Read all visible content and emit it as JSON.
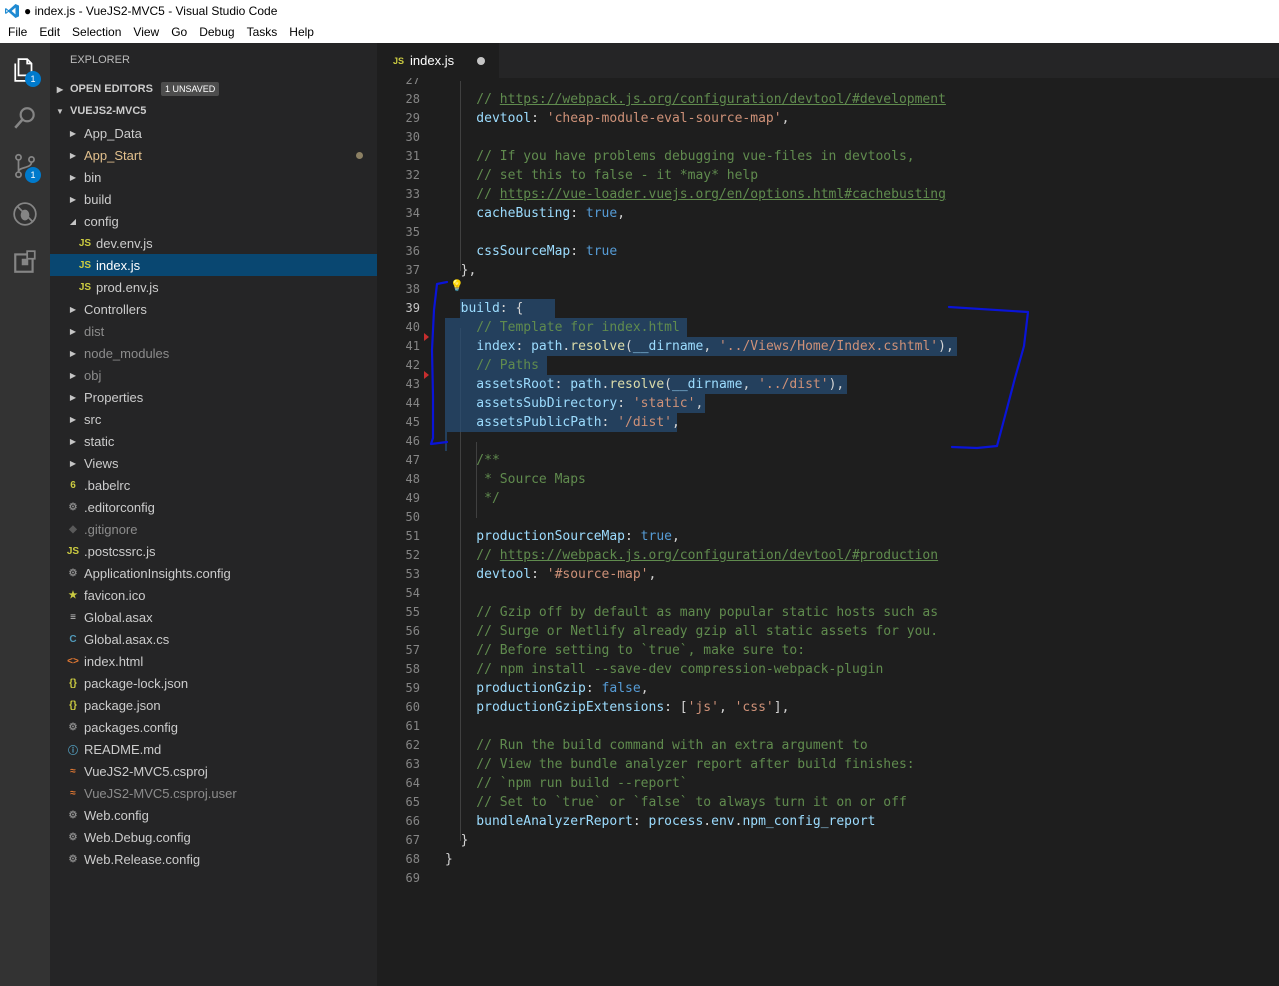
{
  "window": {
    "title": "● index.js - VueJS2-MVC5 - Visual Studio Code"
  },
  "menu": [
    "File",
    "Edit",
    "Selection",
    "View",
    "Go",
    "Debug",
    "Tasks",
    "Help"
  ],
  "activity_bar": {
    "items": [
      {
        "name": "explorer-icon",
        "badge": "1"
      },
      {
        "name": "search-icon",
        "badge": ""
      },
      {
        "name": "source-control-icon",
        "badge": "1"
      },
      {
        "name": "debug-icon",
        "badge": ""
      },
      {
        "name": "extensions-icon",
        "badge": ""
      }
    ]
  },
  "sidebar": {
    "header": "EXPLORER",
    "open_editors": {
      "label": "OPEN EDITORS",
      "badge": "1 UNSAVED"
    },
    "project": {
      "label": "VUEJS2-MVC5"
    },
    "tree": [
      {
        "label": "App_Data",
        "type": "folder",
        "depth": 0,
        "expanded": false
      },
      {
        "label": "App_Start",
        "type": "folder",
        "depth": 0,
        "expanded": false,
        "modified": true,
        "color": "#e2c08d"
      },
      {
        "label": "bin",
        "type": "folder",
        "depth": 0,
        "expanded": false
      },
      {
        "label": "build",
        "type": "folder",
        "depth": 0,
        "expanded": false
      },
      {
        "label": "config",
        "type": "folder",
        "depth": 0,
        "expanded": true
      },
      {
        "label": "dev.env.js",
        "type": "js",
        "depth": 1
      },
      {
        "label": "index.js",
        "type": "js",
        "depth": 1,
        "selected": true
      },
      {
        "label": "prod.env.js",
        "type": "js",
        "depth": 1
      },
      {
        "label": "Controllers",
        "type": "folder",
        "depth": 0,
        "expanded": false
      },
      {
        "label": "dist",
        "type": "folder",
        "depth": 0,
        "expanded": false,
        "color": "#8c8c8c"
      },
      {
        "label": "node_modules",
        "type": "folder",
        "depth": 0,
        "expanded": false,
        "color": "#8c8c8c"
      },
      {
        "label": "obj",
        "type": "folder",
        "depth": 0,
        "expanded": false,
        "color": "#8c8c8c"
      },
      {
        "label": "Properties",
        "type": "folder",
        "depth": 0,
        "expanded": false
      },
      {
        "label": "src",
        "type": "folder",
        "depth": 0,
        "expanded": false
      },
      {
        "label": "static",
        "type": "folder",
        "depth": 0,
        "expanded": false
      },
      {
        "label": "Views",
        "type": "folder",
        "depth": 0,
        "expanded": false
      },
      {
        "label": ".babelrc",
        "type": "babel",
        "depth": 0
      },
      {
        "label": ".editorconfig",
        "type": "gear",
        "depth": 0
      },
      {
        "label": ".gitignore",
        "type": "git",
        "depth": 0,
        "color": "#8c8c8c"
      },
      {
        "label": ".postcssrc.js",
        "type": "js",
        "depth": 0
      },
      {
        "label": "ApplicationInsights.config",
        "type": "gear",
        "depth": 0
      },
      {
        "label": "favicon.ico",
        "type": "star",
        "depth": 0
      },
      {
        "label": "Global.asax",
        "type": "lines",
        "depth": 0
      },
      {
        "label": "Global.asax.cs",
        "type": "cs",
        "depth": 0
      },
      {
        "label": "index.html",
        "type": "html",
        "depth": 0
      },
      {
        "label": "package-lock.json",
        "type": "json",
        "depth": 0
      },
      {
        "label": "package.json",
        "type": "json",
        "depth": 0
      },
      {
        "label": "packages.config",
        "type": "gear",
        "depth": 0
      },
      {
        "label": "README.md",
        "type": "info",
        "depth": 0
      },
      {
        "label": "VueJS2-MVC5.csproj",
        "type": "rss",
        "depth": 0
      },
      {
        "label": "VueJS2-MVC5.csproj.user",
        "type": "rss",
        "depth": 0,
        "color": "#8c8c8c"
      },
      {
        "label": "Web.config",
        "type": "gear",
        "depth": 0
      },
      {
        "label": "Web.Debug.config",
        "type": "gear",
        "depth": 0
      },
      {
        "label": "Web.Release.config",
        "type": "gear",
        "depth": 0
      }
    ]
  },
  "tab": {
    "icon": "JS",
    "label": "index.js"
  },
  "editor": {
    "active_line": "39",
    "lines": [
      {
        "n": "27",
        "tokens": []
      },
      {
        "n": "28",
        "tokens": [
          [
            "c",
            "    // "
          ],
          [
            "u",
            "https://webpack.js.org/configuration/devtool/#development"
          ]
        ]
      },
      {
        "n": "29",
        "tokens": [
          [
            "p",
            "    devtool"
          ],
          [
            "w",
            ": "
          ],
          [
            "s",
            "'cheap-module-eval-source-map'"
          ],
          [
            "w",
            ","
          ]
        ]
      },
      {
        "n": "30",
        "tokens": []
      },
      {
        "n": "31",
        "tokens": [
          [
            "c",
            "    // If you have problems debugging vue-files in devtools,"
          ]
        ]
      },
      {
        "n": "32",
        "tokens": [
          [
            "c",
            "    // set this to false - it *may* help"
          ]
        ]
      },
      {
        "n": "33",
        "tokens": [
          [
            "c",
            "    // "
          ],
          [
            "u",
            "https://vue-loader.vuejs.org/en/options.html#cachebusting"
          ]
        ]
      },
      {
        "n": "34",
        "tokens": [
          [
            "p",
            "    cacheBusting"
          ],
          [
            "w",
            ": "
          ],
          [
            "k",
            "true"
          ],
          [
            "w",
            ","
          ]
        ]
      },
      {
        "n": "35",
        "tokens": []
      },
      {
        "n": "36",
        "tokens": [
          [
            "p",
            "    cssSourceMap"
          ],
          [
            "w",
            ": "
          ],
          [
            "k",
            "true"
          ]
        ]
      },
      {
        "n": "37",
        "tokens": [
          [
            "w",
            "  },"
          ]
        ]
      },
      {
        "n": "38",
        "tokens": []
      },
      {
        "n": "39",
        "tokens": [
          [
            "p",
            "  build"
          ],
          [
            "w",
            ": {"
          ]
        ]
      },
      {
        "n": "40",
        "tokens": [
          [
            "c",
            "    // Template for index.html"
          ]
        ]
      },
      {
        "n": "41",
        "tokens": [
          [
            "p",
            "    index"
          ],
          [
            "w",
            ": "
          ],
          [
            "p",
            "path"
          ],
          [
            "w",
            "."
          ],
          [
            "f",
            "resolve"
          ],
          [
            "w",
            "("
          ],
          [
            "p",
            "__dirname"
          ],
          [
            "w",
            ", "
          ],
          [
            "s",
            "'../Views/Home/Index.cshtml'"
          ],
          [
            "w",
            "),"
          ]
        ]
      },
      {
        "n": "42",
        "tokens": [
          [
            "c",
            "    // Paths"
          ]
        ]
      },
      {
        "n": "43",
        "tokens": [
          [
            "p",
            "    assetsRoot"
          ],
          [
            "w",
            ": "
          ],
          [
            "p",
            "path"
          ],
          [
            "w",
            "."
          ],
          [
            "f",
            "resolve"
          ],
          [
            "w",
            "("
          ],
          [
            "p",
            "__dirname"
          ],
          [
            "w",
            ", "
          ],
          [
            "s",
            "'../dist'"
          ],
          [
            "w",
            "),"
          ]
        ]
      },
      {
        "n": "44",
        "tokens": [
          [
            "p",
            "    assetsSubDirectory"
          ],
          [
            "w",
            ": "
          ],
          [
            "s",
            "'static'"
          ],
          [
            "w",
            ","
          ]
        ]
      },
      {
        "n": "45",
        "tokens": [
          [
            "p",
            "    assetsPublicPath"
          ],
          [
            "w",
            ": "
          ],
          [
            "s",
            "'/dist'"
          ],
          [
            "w",
            ","
          ]
        ]
      },
      {
        "n": "46",
        "tokens": []
      },
      {
        "n": "47",
        "tokens": [
          [
            "c",
            "    /**"
          ]
        ]
      },
      {
        "n": "48",
        "tokens": [
          [
            "c",
            "     * Source Maps"
          ]
        ]
      },
      {
        "n": "49",
        "tokens": [
          [
            "c",
            "     */"
          ]
        ]
      },
      {
        "n": "50",
        "tokens": []
      },
      {
        "n": "51",
        "tokens": [
          [
            "p",
            "    productionSourceMap"
          ],
          [
            "w",
            ": "
          ],
          [
            "k",
            "true"
          ],
          [
            "w",
            ","
          ]
        ]
      },
      {
        "n": "52",
        "tokens": [
          [
            "c",
            "    // "
          ],
          [
            "u",
            "https://webpack.js.org/configuration/devtool/#production"
          ]
        ]
      },
      {
        "n": "53",
        "tokens": [
          [
            "p",
            "    devtool"
          ],
          [
            "w",
            ": "
          ],
          [
            "s",
            "'#source-map'"
          ],
          [
            "w",
            ","
          ]
        ]
      },
      {
        "n": "54",
        "tokens": []
      },
      {
        "n": "55",
        "tokens": [
          [
            "c",
            "    // Gzip off by default as many popular static hosts such as"
          ]
        ]
      },
      {
        "n": "56",
        "tokens": [
          [
            "c",
            "    // Surge or Netlify already gzip all static assets for you."
          ]
        ]
      },
      {
        "n": "57",
        "tokens": [
          [
            "c",
            "    // Before setting to `true`, make sure to:"
          ]
        ]
      },
      {
        "n": "58",
        "tokens": [
          [
            "c",
            "    // npm install --save-dev compression-webpack-plugin"
          ]
        ]
      },
      {
        "n": "59",
        "tokens": [
          [
            "p",
            "    productionGzip"
          ],
          [
            "w",
            ": "
          ],
          [
            "k",
            "false"
          ],
          [
            "w",
            ","
          ]
        ]
      },
      {
        "n": "60",
        "tokens": [
          [
            "p",
            "    productionGzipExtensions"
          ],
          [
            "w",
            ": ["
          ],
          [
            "s",
            "'js'"
          ],
          [
            "w",
            ", "
          ],
          [
            "s",
            "'css'"
          ],
          [
            "w",
            "],"
          ]
        ]
      },
      {
        "n": "61",
        "tokens": []
      },
      {
        "n": "62",
        "tokens": [
          [
            "c",
            "    // Run the build command with an extra argument to"
          ]
        ]
      },
      {
        "n": "63",
        "tokens": [
          [
            "c",
            "    // View the bundle analyzer report after build finishes:"
          ]
        ]
      },
      {
        "n": "64",
        "tokens": [
          [
            "c",
            "    // `npm run build --report`"
          ]
        ]
      },
      {
        "n": "65",
        "tokens": [
          [
            "c",
            "    // Set to `true` or `false` to always turn it on or off"
          ]
        ]
      },
      {
        "n": "66",
        "tokens": [
          [
            "p",
            "    bundleAnalyzerReport"
          ],
          [
            "w",
            ": "
          ],
          [
            "p",
            "process"
          ],
          [
            "w",
            "."
          ],
          [
            "p",
            "env"
          ],
          [
            "w",
            "."
          ],
          [
            "p",
            "npm_config_report"
          ]
        ]
      },
      {
        "n": "67",
        "tokens": [
          [
            "w",
            "  }"
          ]
        ]
      },
      {
        "n": "68",
        "tokens": [
          [
            "w",
            "}"
          ]
        ]
      },
      {
        "n": "69",
        "tokens": []
      }
    ]
  },
  "colors": {
    "activity_badge": "#007acc",
    "selection": "#264f78",
    "annotation": "#0a14d8",
    "js_icon": "#cbcb41"
  }
}
